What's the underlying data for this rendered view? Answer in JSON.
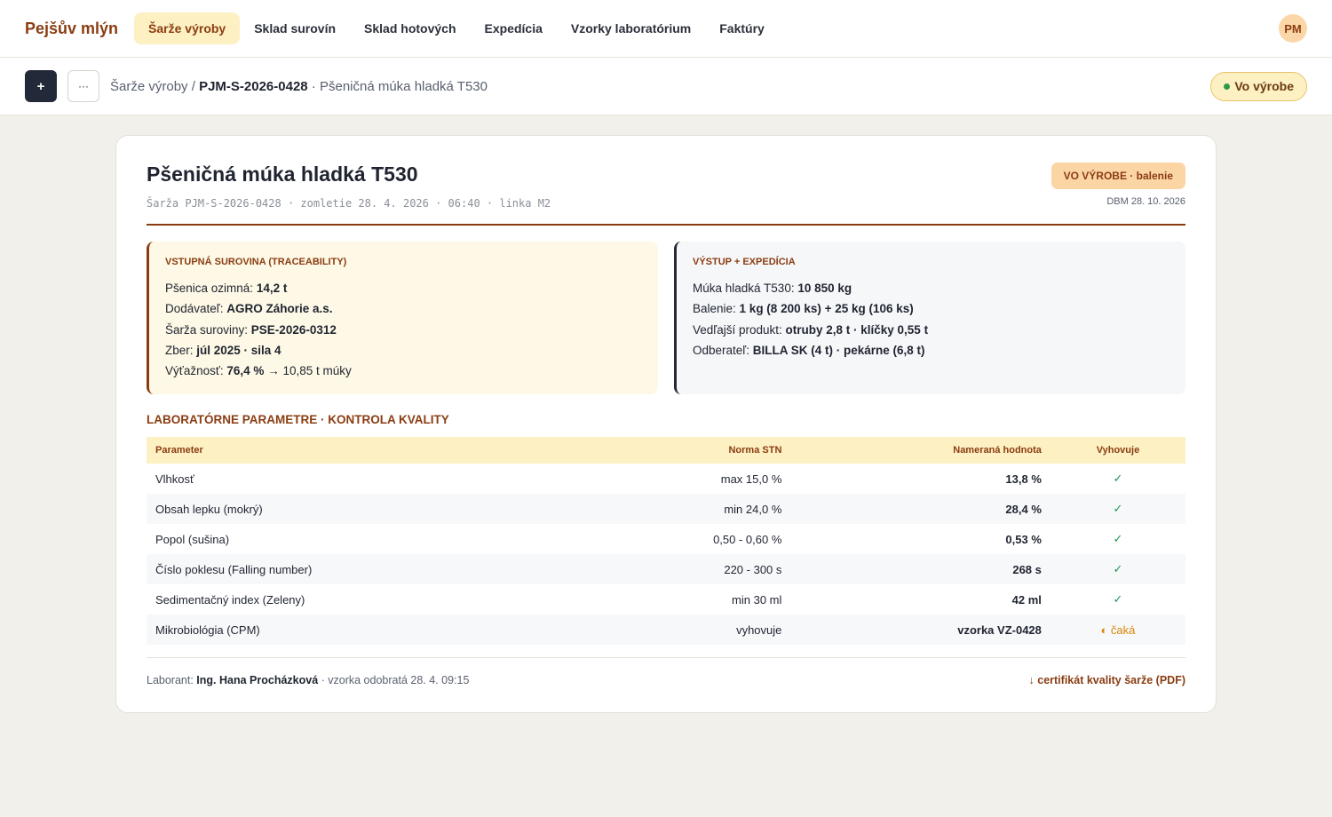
{
  "nav": {
    "brand": "Pejšův mlýn",
    "links": [
      "Šarže výroby",
      "Sklad surovín",
      "Sklad hotových",
      "Expedícia",
      "Vzorky laboratórium",
      "Faktúry"
    ],
    "avatar": "PM"
  },
  "subbar": {
    "add_label": "+",
    "more_label": "···",
    "crumb_root": "Šarže výroby",
    "crumb_sep": " / ",
    "crumb_id": "PJM-S-2026-0428",
    "crumb_tail": " · Pšeničná múka hladká T530",
    "status": "Vo výrobe"
  },
  "card": {
    "title": "Pšeničná múka hladká T530",
    "subtitle": "Šarža PJM-S-2026-0428 · zomletie 28. 4. 2026 · 06:40 · linka M2",
    "badge": "VO VÝROBE · balenie",
    "dbm": "DBM 28. 10. 2026"
  },
  "input_box": {
    "title": "VSTUPNÁ SUROVINA (TRACEABILITY)",
    "rows": [
      {
        "label": "Pšenica ozimná: ",
        "value": "14,2 t",
        "rest": ""
      },
      {
        "label": "Dodávateľ: ",
        "value": "AGRO Záhorie a.s.",
        "rest": ""
      },
      {
        "label": "Šarža suroviny: ",
        "value": "PSE-2026-0312",
        "rest": ""
      },
      {
        "label": "Zber: ",
        "value": "júl 2025 · sila 4",
        "rest": ""
      },
      {
        "label": "Výťažnosť: ",
        "value": "76,4 %",
        "rest": " → 10,85 t múky"
      }
    ]
  },
  "output_box": {
    "title": "VÝSTUP + EXPEDÍCIA",
    "rows": [
      {
        "label": "Múka hladká T530: ",
        "value": "10 850 kg"
      },
      {
        "label": "Balenie: ",
        "value": "1 kg (8 200 ks) + 25 kg (106 ks)"
      },
      {
        "label": "Vedľajší produkt: ",
        "value": "otruby 2,8 t · klíčky 0,55 t"
      },
      {
        "label": "Odberateľ: ",
        "value": "BILLA SK (4 t) · pekárne (6,8 t)"
      }
    ]
  },
  "lab": {
    "title": "LABORATÓRNE PARAMETRE · KONTROLA KVALITY",
    "columns": [
      "Parameter",
      "Norma STN",
      "Nameraná hodnota",
      "Vyhovuje"
    ],
    "rows": [
      {
        "param": "Vlhkosť",
        "norm": "max 15,0 %",
        "value": "13,8 %",
        "ok": "✓",
        "state": "ok"
      },
      {
        "param": "Obsah lepku (mokrý)",
        "norm": "min 24,0 %",
        "value": "28,4 %",
        "ok": "✓",
        "state": "ok"
      },
      {
        "param": "Popol (sušina)",
        "norm": "0,50 - 0,60 %",
        "value": "0,53 %",
        "ok": "✓",
        "state": "ok"
      },
      {
        "param": "Číslo poklesu (Falling number)",
        "norm": "220 - 300 s",
        "value": "268 s",
        "ok": "✓",
        "state": "ok"
      },
      {
        "param": "Sedimentačný index (Zeleny)",
        "norm": "min 30 ml",
        "value": "42 ml",
        "ok": "✓",
        "state": "ok"
      },
      {
        "param": "Mikrobiológia (CPM)",
        "norm": "vyhovuje",
        "value": "vzorka VZ-0428",
        "ok": "◐ čaká",
        "state": "wait"
      }
    ]
  },
  "footer": {
    "label": "Laborant: ",
    "name": "Ing. Hana Procházková",
    "rest": " · vzorka odobratá 28. 4. 09:15",
    "pdf": "↓ certifikát kvality šarže (PDF)"
  }
}
